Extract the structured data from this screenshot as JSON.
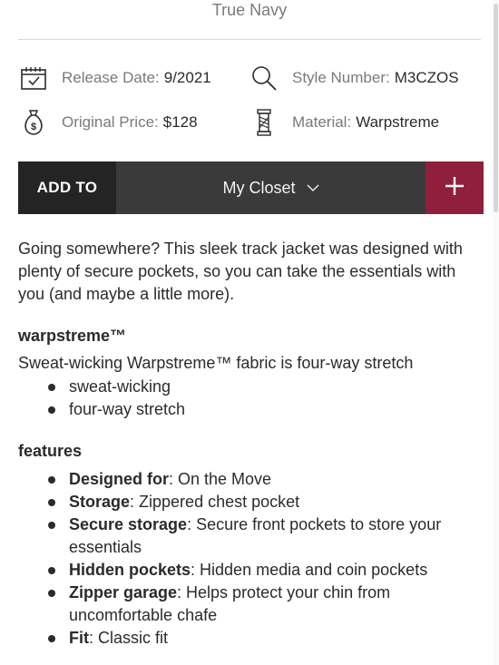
{
  "color_name": "True Navy",
  "specs": {
    "release_date": {
      "label": "Release Date:",
      "value": "9/2021"
    },
    "style_number": {
      "label": "Style Number:",
      "value": "M3CZOS"
    },
    "original_price": {
      "label": "Original Price:",
      "value": "$128"
    },
    "material": {
      "label": "Material:",
      "value": "Warpstreme"
    }
  },
  "add_bar": {
    "add_label": "ADD TO",
    "closet_selected": "My Closet",
    "plus_glyph": "+",
    "accent_color": "#8f1f3b"
  },
  "description": "Going somewhere? This sleek track jacket was designed with plenty of secure pockets, so you can take the essentials with you (and maybe a little more).",
  "fabric": {
    "heading": "warpstreme™",
    "summary": "Sweat-wicking Warpstreme™ fabric is four-way stretch",
    "bullets": [
      "sweat-wicking",
      "four-way stretch"
    ]
  },
  "features": {
    "heading": "features",
    "items": [
      {
        "label": "Designed for",
        "text": ": On the Move"
      },
      {
        "label": "Storage",
        "text": ": Zippered chest pocket"
      },
      {
        "label": "Secure storage",
        "text": ": Secure front pockets to store your essentials"
      },
      {
        "label": "Hidden pockets",
        "text": ": Hidden media and coin pockets"
      },
      {
        "label": "Zipper garage",
        "text": ": Helps protect your chin from uncomfortable chafe"
      },
      {
        "label": "Fit",
        "text": ": Classic fit"
      }
    ]
  },
  "icons": {
    "release_date": "calendar-icon",
    "style_number": "magnifier-icon",
    "original_price": "money-bag-icon",
    "material": "fabric-spool-icon",
    "closet_dropdown": "chevron-down-icon",
    "add": "plus-icon"
  }
}
